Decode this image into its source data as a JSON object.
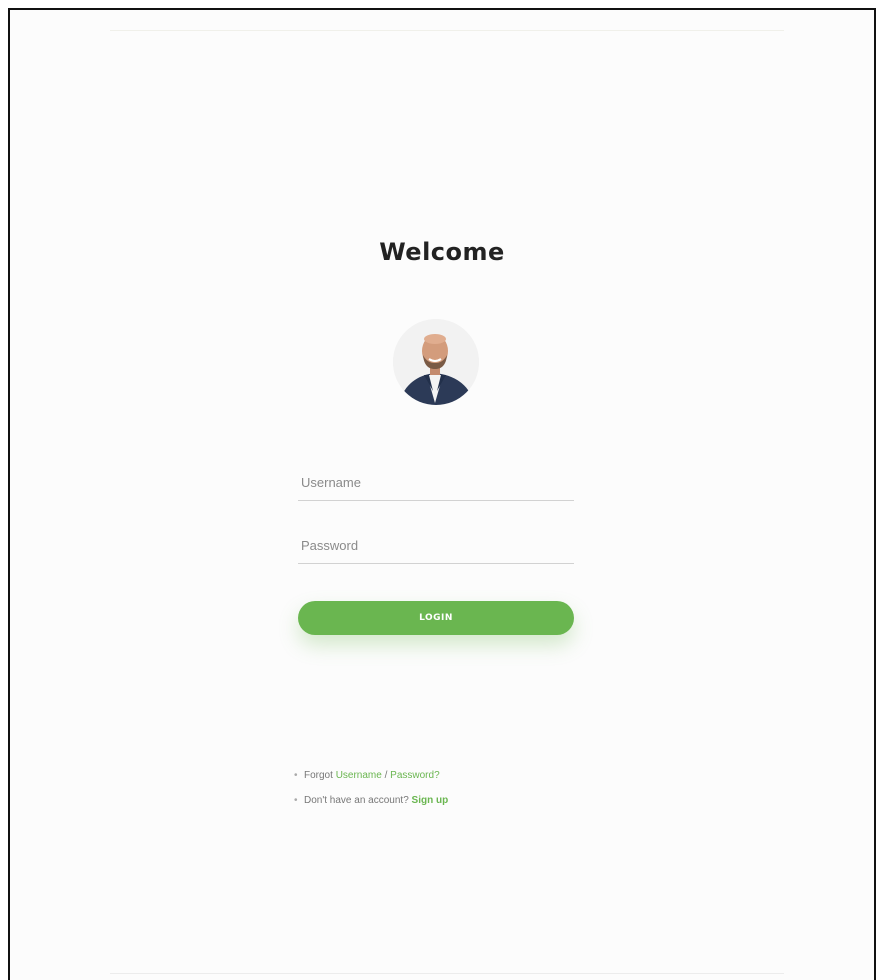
{
  "colors": {
    "accent": "#6ab650",
    "title": "#222222",
    "muted": "#777777"
  },
  "login": {
    "title": "Welcome",
    "avatar_icon": "profile-photo",
    "username_placeholder": "Username",
    "password_placeholder": "Password",
    "login_button": "LOGIN"
  },
  "links": {
    "forgot_prefix": "Forgot ",
    "forgot_username": "Username",
    "separator": " / ",
    "forgot_password": "Password?",
    "no_account": "Don't have an account? ",
    "sign_up": "Sign up"
  }
}
